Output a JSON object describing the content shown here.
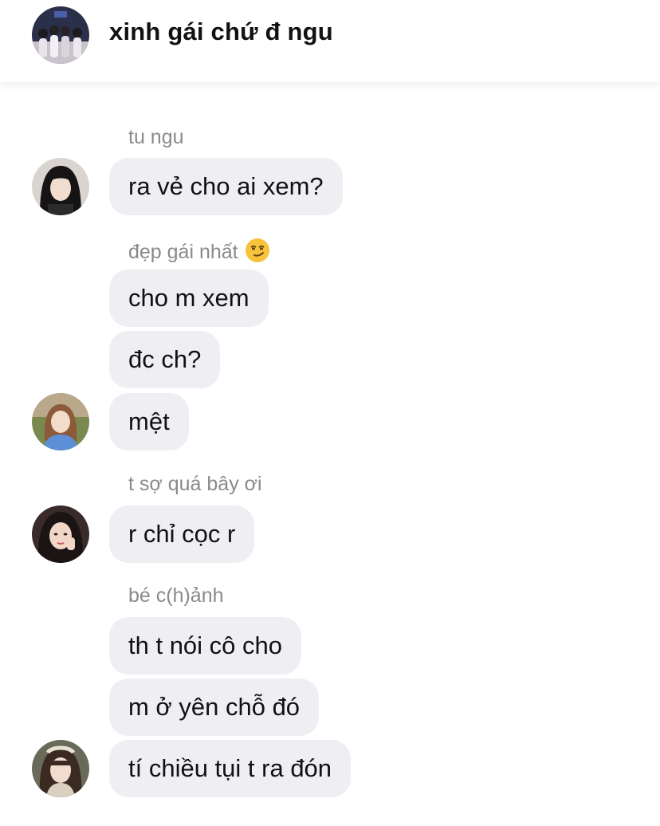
{
  "header": {
    "title": "xinh gái chứ đ ngu",
    "avatar_icon": "group-avatar-icon"
  },
  "messages": [
    {
      "sender": "tu ngu",
      "bubbles": [
        "ra vẻ cho ai xem?"
      ],
      "avatar_icon": "user-avatar-icon"
    },
    {
      "sender": "đẹp gái nhất",
      "sender_emoji": "smirk-emoji-icon",
      "bubbles": [
        "cho m xem",
        "đc ch?",
        "mệt"
      ],
      "avatar_icon": "user-avatar-icon"
    },
    {
      "sender": "t sợ quá bây ơi",
      "bubbles": [
        "r chỉ cọc r"
      ],
      "avatar_icon": "user-avatar-icon"
    },
    {
      "sender": "bé c(h)ảnh",
      "bubbles": [
        "th t nói cô cho",
        "m ở yên chỗ đó",
        "tí chiều tụi t ra đón"
      ],
      "avatar_icon": "user-avatar-icon"
    }
  ],
  "colors": {
    "bubble_bg": "#efeff3",
    "sender_text": "#8a8a8e",
    "message_text": "#111111"
  }
}
